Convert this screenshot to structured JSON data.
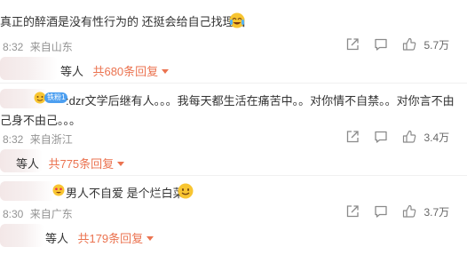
{
  "comments": [
    {
      "text": "真正的醉酒是没有性行为的 还挺会给自己找理由",
      "time": "8:32",
      "location": "来自山东",
      "likes": "5.7万",
      "reply_names": "等人",
      "reply_link": "共680条回复",
      "icons": [
        "share-icon",
        "comment-icon",
        "like-icon"
      ]
    },
    {
      "badge": "铁粉1",
      "text_line1": ":dzr文学后继有人。。。我每天都生活在痛苦中。。对你情不自禁。。对你言不由",
      "text_line2": "己身不由己。。。",
      "time": "8:32",
      "location": "来自浙江",
      "likes": "3.4万",
      "reply_names": "等人",
      "reply_link": "共775条回复"
    },
    {
      "text": "男人不自爱 是个烂白菜",
      "time": "8:30",
      "location": "来自广东",
      "likes": "3.7万",
      "reply_names": "等人",
      "reply_link": "共179条回复"
    }
  ]
}
